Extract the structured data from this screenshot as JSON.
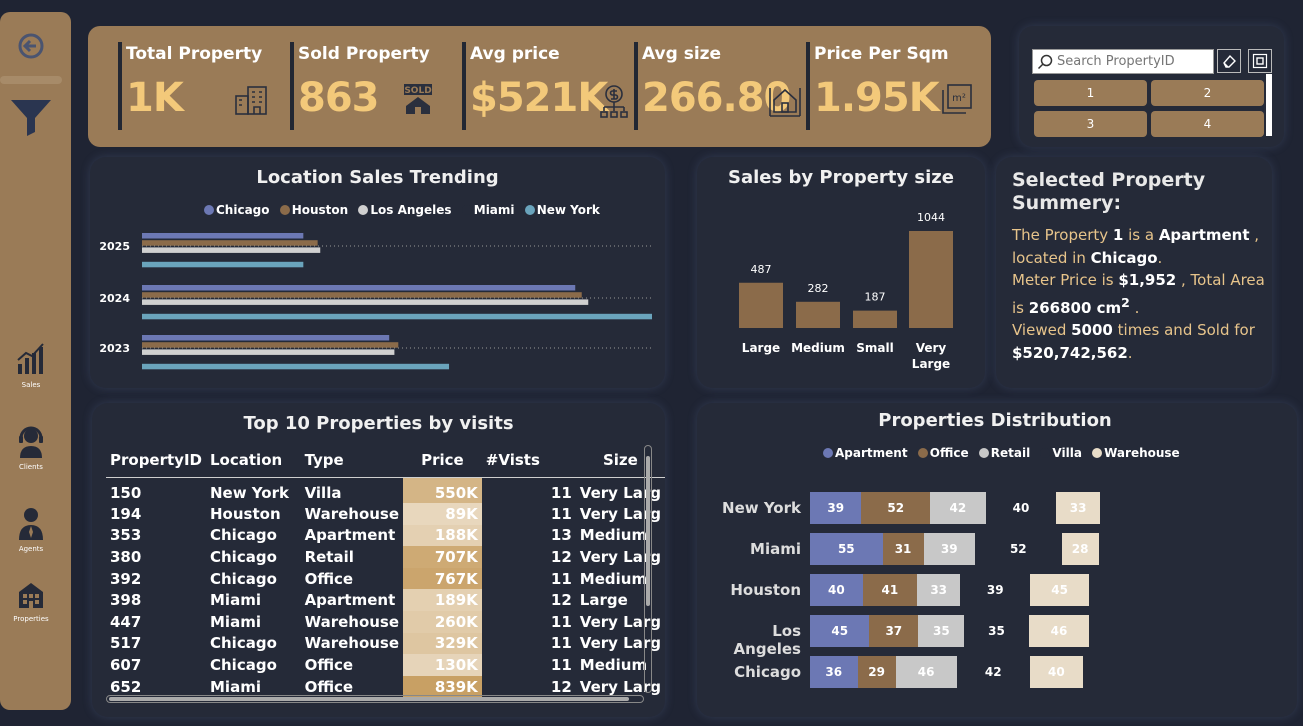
{
  "colors": {
    "background": "#1f2433",
    "card": "#252a38",
    "gold": "#9a7b57",
    "kpi_value": "#f3c97a",
    "chicago": "#6c78b4",
    "houston": "#8b6b4a",
    "los_angeles": "#d0d0d0",
    "miami": "#252a38",
    "new_york": "#6aa4bc",
    "apartment": "#6c78b4",
    "office": "#8b6b4a",
    "retail": "#c8c8c8",
    "villa": "#252a38",
    "warehouse": "#e8dcc8"
  },
  "sidebar": {
    "back_icon": "back-arrow-icon",
    "filter_icon": "filter-icon",
    "items": [
      {
        "label": "Sales",
        "icon": "bar-chart-icon"
      },
      {
        "label": "Clients",
        "icon": "headset-icon"
      },
      {
        "label": "Agents",
        "icon": "agent-icon"
      },
      {
        "label": "Properties",
        "icon": "building-icon"
      }
    ]
  },
  "kpis": [
    {
      "title": "Total Property",
      "value": "1K",
      "icon": "building-icon"
    },
    {
      "title": "Sold Property",
      "value": "863",
      "icon": "sold-house-icon"
    },
    {
      "title": "Avg price",
      "value": "$521K",
      "icon": "money-icon"
    },
    {
      "title": "Avg size",
      "value": "266.80",
      "icon": "house-size-icon"
    },
    {
      "title": "Price Per Sqm",
      "value": "1.95K",
      "icon": "square-meter-icon"
    }
  ],
  "slicer": {
    "placeholder": "Search PropertyID",
    "tiles": [
      "1",
      "2",
      "3",
      "4"
    ]
  },
  "location_chart": {
    "title": "Location Sales Trending",
    "legend": [
      "Chicago",
      "Houston",
      "Los Angeles",
      "Miami",
      "New York"
    ]
  },
  "size_chart": {
    "title": "Sales by Property size"
  },
  "summary": {
    "title_line1": "Selected Property",
    "title_line2": "Summery:",
    "t1": "The Property ",
    "id": "1",
    "t2": " is a ",
    "type": "Apartment",
    "t3": " ,",
    "t4": "located in ",
    "city": "Chicago",
    "t5": ".",
    "t6": "Meter Price  is ",
    "meter_price": "$1,952",
    "t7": " , Total Area",
    "t8": "is ",
    "area": "266800 cm",
    "area_sup": "2",
    "t9": " .",
    "t10": "Viewed ",
    "views": "5000",
    "t11": " times and Sold for",
    "sold_for": "$520,742,562",
    "t12": "."
  },
  "top10": {
    "title": "Top 10 Properties by visits",
    "headers": [
      "PropertyID",
      "Location",
      "Type",
      "Price",
      "#Vists",
      "Size"
    ],
    "rows": [
      {
        "id": "150",
        "location": "New York",
        "type": "Villa",
        "price": "550K",
        "price_value": 550,
        "visits": "11",
        "size": "Very Larg"
      },
      {
        "id": "194",
        "location": "Houston",
        "type": "Warehouse",
        "price": "89K",
        "price_value": 89,
        "visits": "11",
        "size": "Very Larg"
      },
      {
        "id": "353",
        "location": "Chicago",
        "type": "Apartment",
        "price": "188K",
        "price_value": 188,
        "visits": "13",
        "size": "Medium"
      },
      {
        "id": "380",
        "location": "Chicago",
        "type": "Retail",
        "price": "707K",
        "price_value": 707,
        "visits": "12",
        "size": "Very Larg"
      },
      {
        "id": "392",
        "location": "Chicago",
        "type": "Office",
        "price": "767K",
        "price_value": 767,
        "visits": "11",
        "size": "Medium"
      },
      {
        "id": "398",
        "location": "Miami",
        "type": "Apartment",
        "price": "189K",
        "price_value": 189,
        "visits": "12",
        "size": "Large"
      },
      {
        "id": "447",
        "location": "Miami",
        "type": "Warehouse",
        "price": "260K",
        "price_value": 260,
        "visits": "11",
        "size": "Very Larg"
      },
      {
        "id": "517",
        "location": "Chicago",
        "type": "Warehouse",
        "price": "329K",
        "price_value": 329,
        "visits": "11",
        "size": "Very Larg"
      },
      {
        "id": "607",
        "location": "Chicago",
        "type": "Office",
        "price": "130K",
        "price_value": 130,
        "visits": "11",
        "size": "Medium"
      },
      {
        "id": "652",
        "location": "Miami",
        "type": "Office",
        "price": "839K",
        "price_value": 839,
        "visits": "12",
        "size": "Very Larg"
      }
    ]
  },
  "distribution_chart": {
    "title": "Properties Distribution",
    "legend": [
      "Apartment",
      "Office",
      "Retail",
      "Villa",
      "Warehouse"
    ]
  },
  "chart_data": [
    {
      "type": "bar",
      "orientation": "horizontal",
      "title": "Location Sales Trending",
      "categories": [
        "2025",
        "2024",
        "2023"
      ],
      "series": [
        {
          "name": "Chicago",
          "values": [
            124,
            333,
            190
          ]
        },
        {
          "name": "Houston",
          "values": [
            135,
            338,
            197
          ]
        },
        {
          "name": "Los Angeles",
          "values": [
            137,
            343,
            194
          ]
        },
        {
          "name": "Miami",
          "values": [
            0,
            0,
            0
          ]
        },
        {
          "name": "New York",
          "values": [
            124,
            392,
            236
          ]
        }
      ],
      "xlim": [
        0,
        392
      ],
      "legend_position": "top",
      "grid": false
    },
    {
      "type": "bar",
      "title": "Sales by Property size",
      "categories": [
        "Large",
        "Medium",
        "Small",
        "Very Large"
      ],
      "values": [
        487,
        282,
        187,
        1044
      ],
      "ylim": [
        0,
        1044
      ],
      "data_labels": true
    },
    {
      "type": "bar",
      "orientation": "horizontal",
      "stacked": true,
      "title": "Properties Distribution",
      "categories": [
        "New York",
        "Miami",
        "Houston",
        "Los Angeles",
        "Chicago"
      ],
      "series": [
        {
          "name": "Apartment",
          "values": [
            39,
            55,
            40,
            45,
            36
          ]
        },
        {
          "name": "Office",
          "values": [
            52,
            31,
            41,
            37,
            29
          ]
        },
        {
          "name": "Retail",
          "values": [
            42,
            39,
            33,
            35,
            46
          ]
        },
        {
          "name": "Villa",
          "values": [
            40,
            52,
            39,
            35,
            42
          ]
        },
        {
          "name": "Warehouse",
          "values": [
            33,
            28,
            45,
            46,
            40
          ]
        }
      ],
      "legend_position": "top",
      "data_labels": true
    }
  ]
}
